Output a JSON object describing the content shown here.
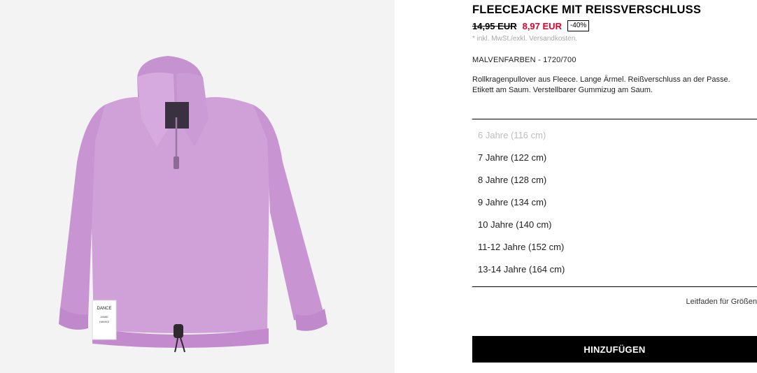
{
  "product": {
    "title": "FLEECEJACKE MIT REISSVERSCHLUSS",
    "old_price": "14,95 EUR",
    "new_price": "8,97 EUR",
    "discount": "-40%",
    "tax_note": "* inkl. MwSt./exkl. Versandkosten.",
    "color_ref": "MALVENFARBEN - 1720/700",
    "description": "Rollkragenpullover aus Fleece. Lange Ärmel. Reißverschluss an der Passe. Etikett am Saum. Verstellbarer Gummizug am Saum.",
    "image_label_text": "DANCE",
    "image_label_lines": [
      "JAMIE",
      "HAWKE"
    ]
  },
  "sizes": [
    {
      "label": "6 Jahre (116 cm)",
      "available": false
    },
    {
      "label": "7 Jahre (122 cm)",
      "available": true
    },
    {
      "label": "8 Jahre (128 cm)",
      "available": true
    },
    {
      "label": "9 Jahre (134 cm)",
      "available": true
    },
    {
      "label": "10 Jahre (140 cm)",
      "available": true
    },
    {
      "label": "11-12 Jahre (152 cm)",
      "available": true
    },
    {
      "label": "13-14 Jahre (164 cm)",
      "available": true
    }
  ],
  "size_guide": "Leitfaden für Größen",
  "add_button": "HINZUFÜGEN",
  "colors": {
    "sale_red": "#e4002b",
    "fleece": "#cf9fd8",
    "image_bg": "#f3f3f3"
  }
}
